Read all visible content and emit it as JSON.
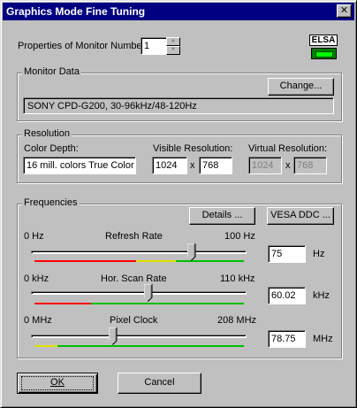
{
  "window": {
    "title": "Graphics Mode Fine Tuning",
    "close_glyph": "✕"
  },
  "monitor_number": {
    "label": "Properties of Monitor Number:",
    "value": "1"
  },
  "logo": {
    "text": "ELSA",
    "icon": "elsa-logo-icon"
  },
  "monitor_data": {
    "group_label": "Monitor Data",
    "change_button": "Change...",
    "monitor_description": "SONY CPD-G200, 30-96kHz/48-120Hz"
  },
  "resolution": {
    "group_label": "Resolution",
    "color_depth_label": "Color Depth:",
    "color_depth_value": "16 mill. colors True Color",
    "visible_label": "Visible Resolution:",
    "visible_width": "1024",
    "visible_height": "768",
    "virtual_label": "Virtual Resolution:",
    "virtual_width": "1024",
    "virtual_height": "768",
    "x_sep": "x"
  },
  "frequencies": {
    "group_label": "Frequencies",
    "details_button": "Details ...",
    "vesa_button": "VESA DDC ...",
    "sliders": [
      {
        "name": "refresh-rate",
        "label": "Refresh Rate",
        "min_label": "0 Hz",
        "max_label": "100 Hz",
        "value": "75",
        "unit": "Hz",
        "position_fraction": 0.75
      },
      {
        "name": "hor-scan-rate",
        "label": "Hor. Scan Rate",
        "min_label": "0 kHz",
        "max_label": "110 kHz",
        "value": "60.02",
        "unit": "kHz",
        "position_fraction": 0.546
      },
      {
        "name": "pixel-clock",
        "label": "Pixel Clock",
        "min_label": "0 MHz",
        "max_label": "208 MHz",
        "value": "78.75",
        "unit": "MHz",
        "position_fraction": 0.379
      }
    ]
  },
  "footer": {
    "ok_button": "OK",
    "cancel_button": "Cancel"
  },
  "colors": {
    "title_bar": "#000080",
    "face": "#c0c0c0",
    "range_red": "#ff0000",
    "range_yellow": "#ffff00",
    "range_green": "#00c000"
  }
}
